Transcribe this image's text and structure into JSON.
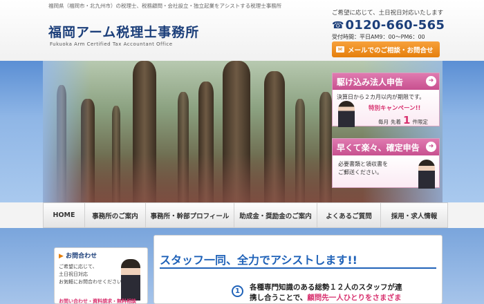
{
  "header": {
    "tagline": "福岡県（福岡市・北九州市）の税理士、税務顧問・会社設立・独立起業をアシストする税理士事務所",
    "logo_title": "福岡アーム税理士事務所",
    "logo_subtitle": "Fukuoka Arm Certified Tax Accountant Office",
    "contact_note": "ご希望に応じて、土日祝日対応いたします",
    "phone_icon": "☎",
    "phone": "0120-660-565",
    "hours": "受付時間：平日AM9：00～PM6：00",
    "mail_button": "メールでのご相談・お問合せ",
    "mail_icon": "✉"
  },
  "promos": {
    "rush": {
      "title": "駆け込み法人申告",
      "line1": "決算日から２カ月以内が期限です。",
      "campaign": "特別キャンペーン!!",
      "limit_prefix": "毎月",
      "limit_mid": "先着",
      "limit_num": "1",
      "limit_suffix": "件限定",
      "arrow": "➜"
    },
    "easy": {
      "title": "早くて楽々、確定申告",
      "line1": "必要書類と領収書を",
      "line2": "ご郵送ください。",
      "arrow": "➜"
    }
  },
  "nav": {
    "items": [
      "HOME",
      "事務所のご案内",
      "事務所・幹部プロフィール",
      "助成金・奨励金のご案内",
      "よくあるご質問",
      "採用・求人情報"
    ]
  },
  "sidebar": {
    "title_mark": "▶",
    "title": "お問合わせ",
    "text1": "ご希望に応じて、",
    "text2": "土日祝日対応",
    "text3": "お気軽にお問合わせください。",
    "footer": "お問い合わせ・資料請求・無料相談"
  },
  "main": {
    "title": "スタッフ一同、全力でアシストします!!",
    "num": "1",
    "line1": "各種専門知識のある総勢１２人のスタッフが連",
    "line2_plain": "携し合うことで、",
    "line2_hl": "顧問先一人ひとりをさまざま"
  },
  "colors": {
    "accent": "#1f62b8",
    "brand": "#1c3f7a",
    "pink": "#d8326f",
    "orange": "#e57f0c"
  }
}
